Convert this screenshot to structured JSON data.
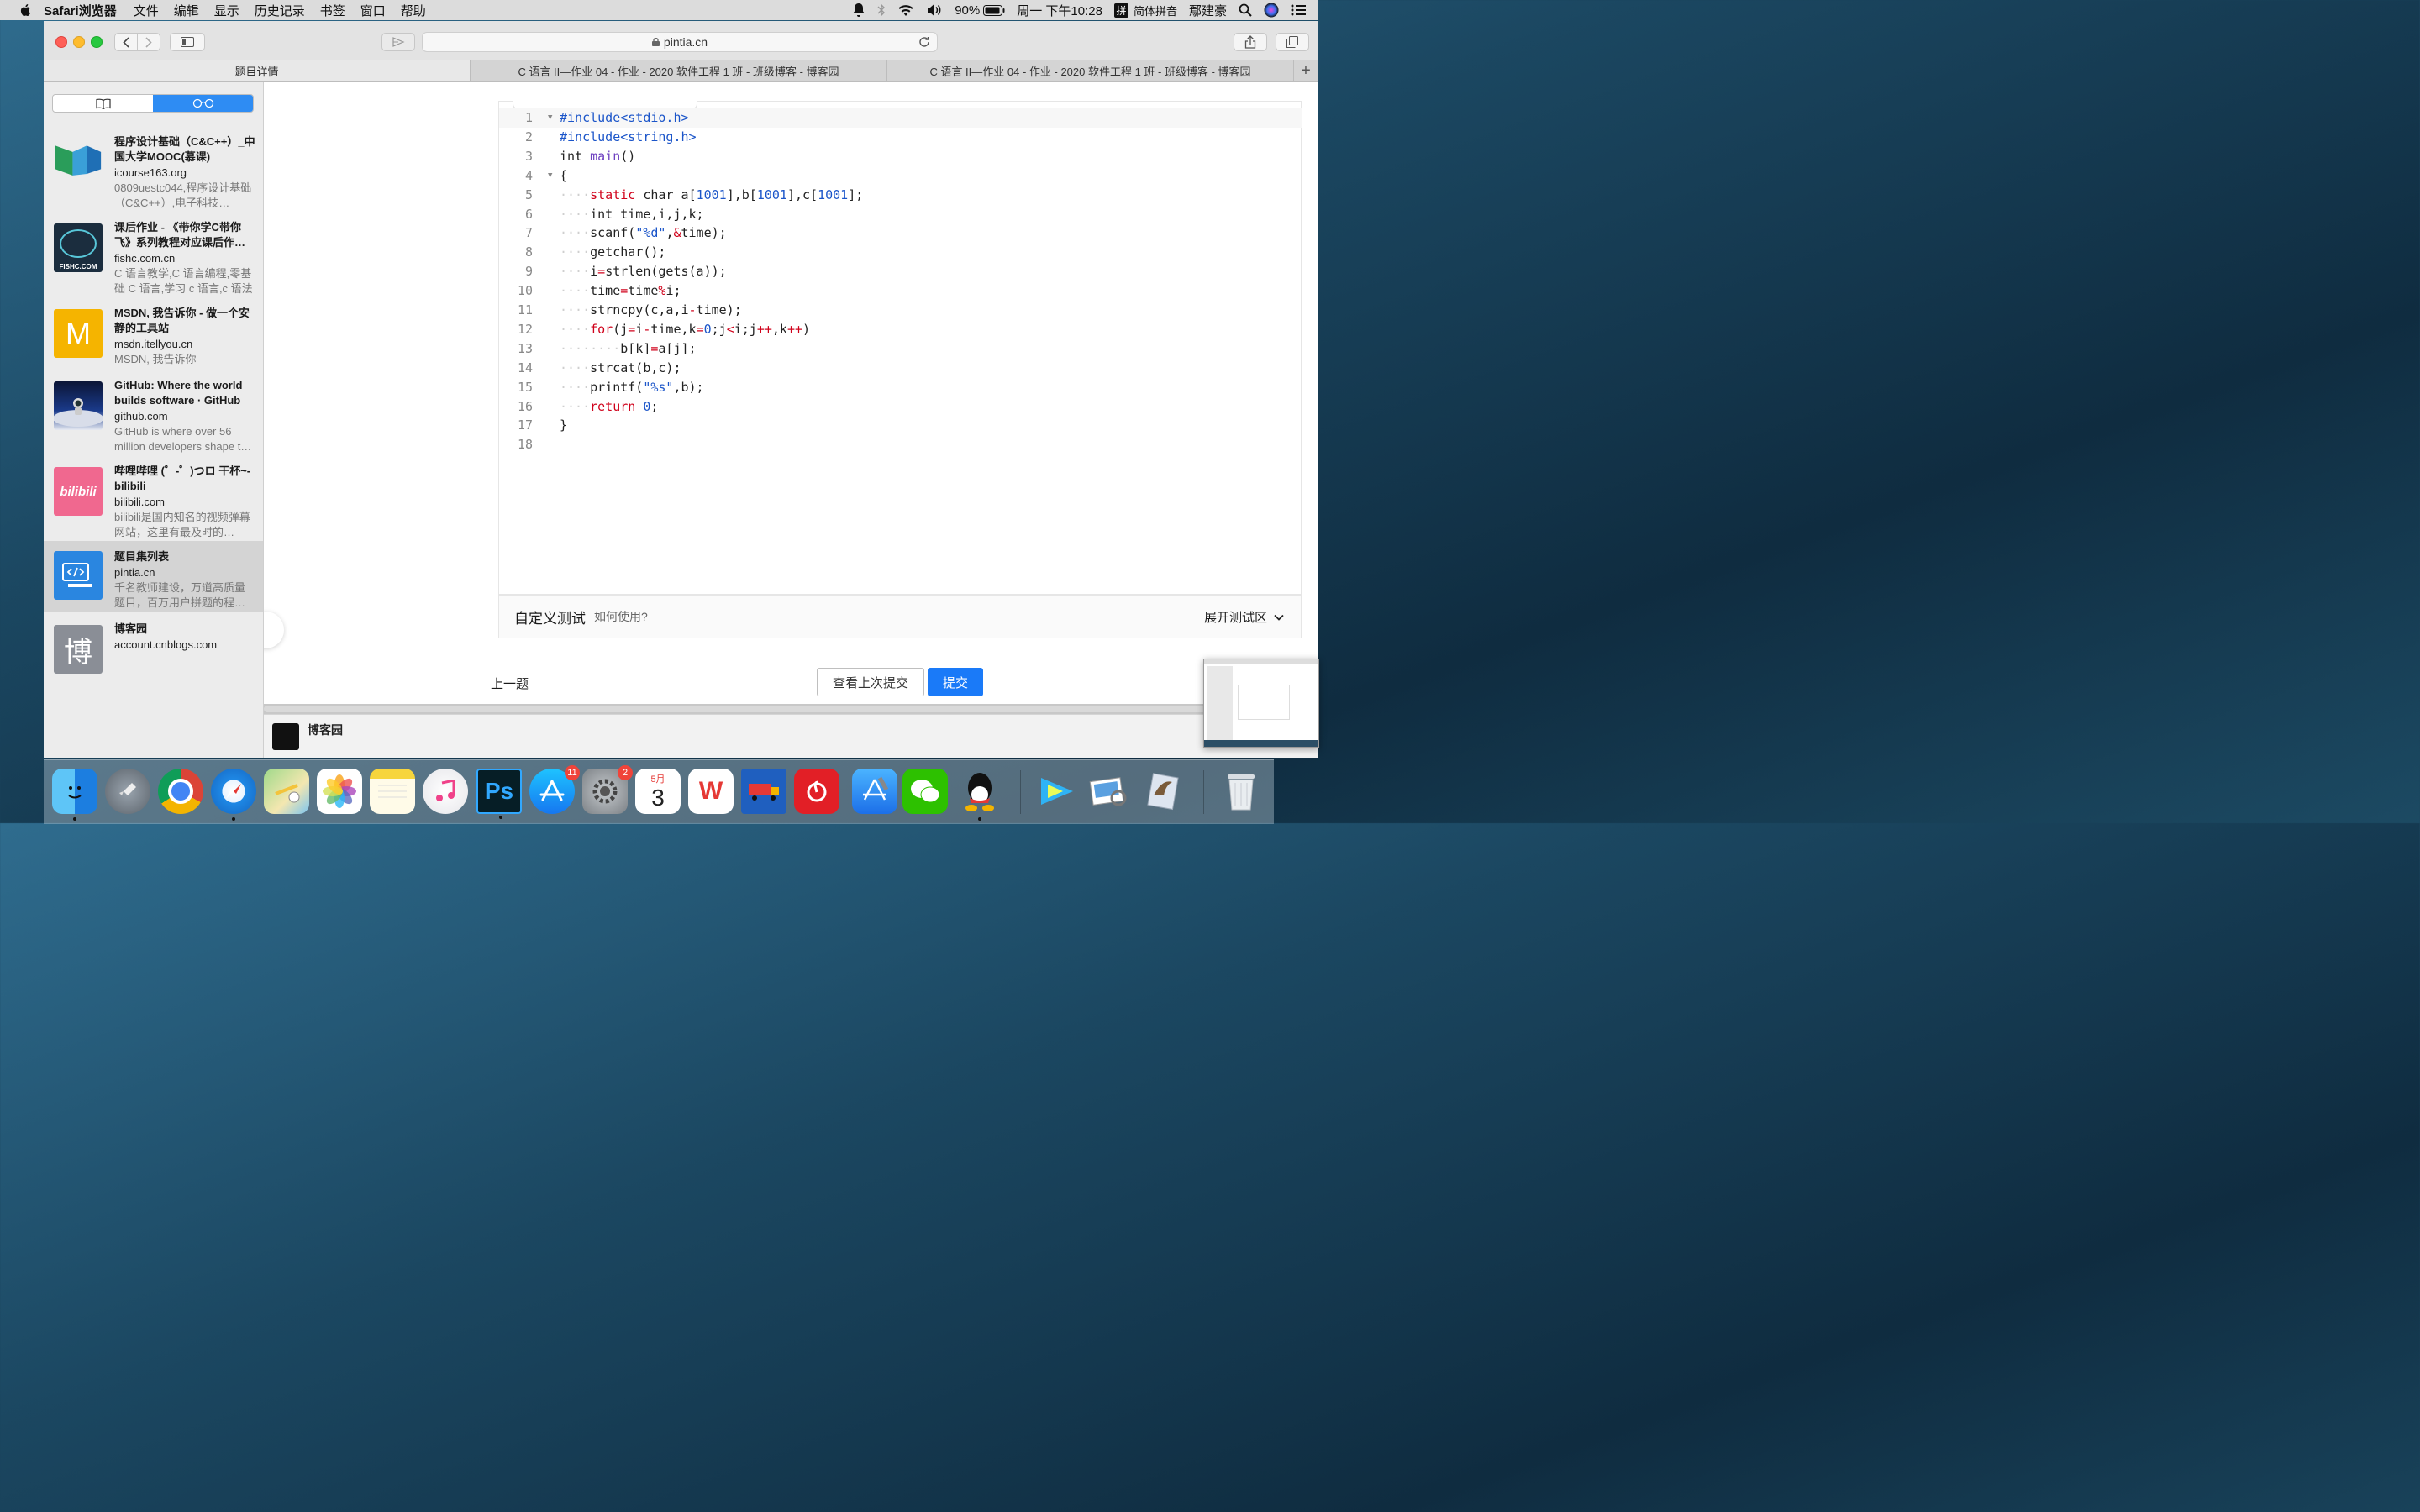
{
  "menubar": {
    "app_name": "Safari浏览器",
    "menus": [
      "文件",
      "编辑",
      "显示",
      "历史记录",
      "书签",
      "窗口",
      "帮助"
    ],
    "battery": "90%",
    "clock": "周一 下午10:28",
    "input_method_badge": "拼",
    "input_method": "简体拼音",
    "user": "鄢建豪"
  },
  "toolbar": {
    "url": "pintia.cn"
  },
  "tabs": [
    {
      "label": "题目详情"
    },
    {
      "label": "C 语言 II—作业 04 - 作业 - 2020 软件工程 1 班 - 班级博客 - 博客园"
    },
    {
      "label": "C 语言 II—作业 04 - 作业 - 2020 软件工程 1 班 - 班级博客 - 博客园"
    }
  ],
  "reading_list": [
    {
      "title": "程序设计基础（C&C++）_中国大学MOOC(慕课)",
      "domain": "icourse163.org",
      "desc": "0809uestc044,程序设计基础（C&C++）,电子科技…",
      "icon": "mooc-icon"
    },
    {
      "title": "课后作业 - 《带你学C带你飞》系列教程对应课后作…",
      "domain": "fishc.com.cn",
      "desc": "C 语言教学,C 语言编程,零基础 C 语言,学习 c 语言,c 语法",
      "icon": "fishc-icon",
      "thumb_text": "FISHC.COM"
    },
    {
      "title": "MSDN, 我告诉你 - 做一个安静的工具站",
      "domain": "msdn.itellyou.cn",
      "desc": "MSDN, 我告诉你",
      "icon": "msdn-icon",
      "thumb_text": "M"
    },
    {
      "title": "GitHub: Where the world builds software · GitHub",
      "domain": "github.com",
      "desc": "GitHub is where over 56 million developers shape t…",
      "icon": "github-icon"
    },
    {
      "title": "哔哩哔哩 (゜-゜)つロ 干杯~-bilibili",
      "domain": "bilibili.com",
      "desc": "bilibili是国内知名的视频弹幕网站，这里有最及时的…",
      "icon": "bilibili-icon",
      "thumb_text": "bilibili"
    },
    {
      "title": "题目集列表",
      "domain": "pintia.cn",
      "desc": "千名教师建设，万道高质量题目，百万用户拼题的程…",
      "icon": "pintia-icon",
      "selected": true
    },
    {
      "title": "博客园",
      "domain": "account.cnblogs.com",
      "desc": "",
      "icon": "cnblogs-icon",
      "thumb_text": "博"
    }
  ],
  "editor": {
    "lines": [
      "#include<stdio.h>",
      "#include<string.h>",
      "int main()",
      "{",
      "    static char a[1001],b[1001],c[1001];",
      "    int time,i,j,k;",
      "    scanf(\"%d\",&time);",
      "    getchar();",
      "    i=strlen(gets(a));",
      "    time=time%i;",
      "    strncpy(c,a,i-time);",
      "    for(j=i-time,k=0;j<i;j++,k++)",
      "        b[k]=a[j];",
      "    strcat(b,c);",
      "    printf(\"%s\",b);",
      "    return 0;",
      "}",
      ""
    ]
  },
  "custom_test": {
    "title": "自定义测试",
    "help": "如何使用?",
    "expand": "展开测试区"
  },
  "actions": {
    "prev": "上一题",
    "view_last": "查看上次提交",
    "submit": "提交"
  },
  "bottom_tab": {
    "label": "博客园"
  },
  "dock": {
    "appstore_badge": "11",
    "settings_badge": "2",
    "calendar_month": "5月",
    "calendar_day": "3"
  },
  "colors": {
    "accent": "#1a7af8",
    "keyword": "#d0021b",
    "preprocessor": "#1b55c9"
  }
}
